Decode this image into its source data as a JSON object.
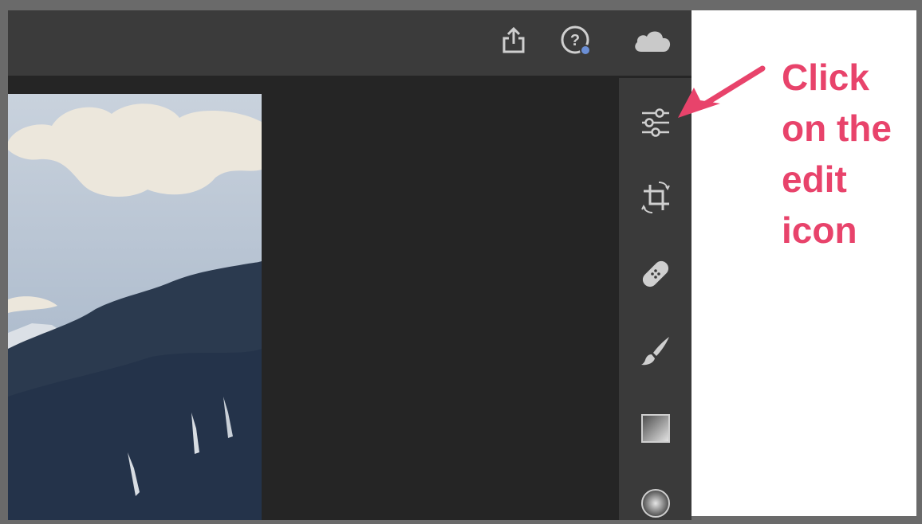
{
  "topbar": {
    "icons": [
      "share-icon",
      "help-icon",
      "cloud-icon"
    ],
    "help_badge_color": "#6b8fd6"
  },
  "toolstrip": {
    "tools": [
      "edit-icon",
      "crop-icon",
      "healing-icon",
      "brush-icon",
      "linear-gradient-icon",
      "radial-gradient-icon"
    ]
  },
  "annotation": {
    "lines": [
      "Click",
      "on the",
      "edit",
      "icon"
    ],
    "color": "#e8436b"
  }
}
